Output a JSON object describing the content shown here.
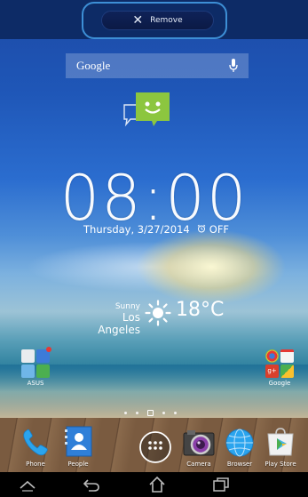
{
  "top_bar": {
    "remove_label": "Remove"
  },
  "search": {
    "logo_text": "Google",
    "mic_icon": "microphone-icon"
  },
  "messaging": {
    "icon": "messaging-smiley-icon",
    "color": "#8cc63f"
  },
  "clock": {
    "time": "08:00",
    "date": "Thursday, 3/27/2014",
    "alarm": "OFF"
  },
  "weather": {
    "condition": "Sunny",
    "city": "Los Angeles",
    "temperature": "18°C",
    "icon": "sun-icon"
  },
  "folders": [
    {
      "label": "ASUS",
      "icon": "asus-folder-icon"
    },
    {
      "label": "Google",
      "icon": "google-folder-icon"
    }
  ],
  "dock": [
    {
      "label": "Phone",
      "icon": "phone-icon"
    },
    {
      "label": "People",
      "icon": "people-icon"
    },
    {
      "label": "",
      "icon": "all-apps-icon"
    },
    {
      "label": "Camera",
      "icon": "camera-icon"
    },
    {
      "label": "Browser",
      "icon": "browser-icon"
    },
    {
      "label": "Play Store",
      "icon": "play-store-icon"
    }
  ],
  "page_indicator": {
    "count": 5,
    "active_index": 2
  },
  "nav": [
    "hide-keyboard-icon",
    "back-icon",
    "home-icon",
    "recents-icon"
  ]
}
